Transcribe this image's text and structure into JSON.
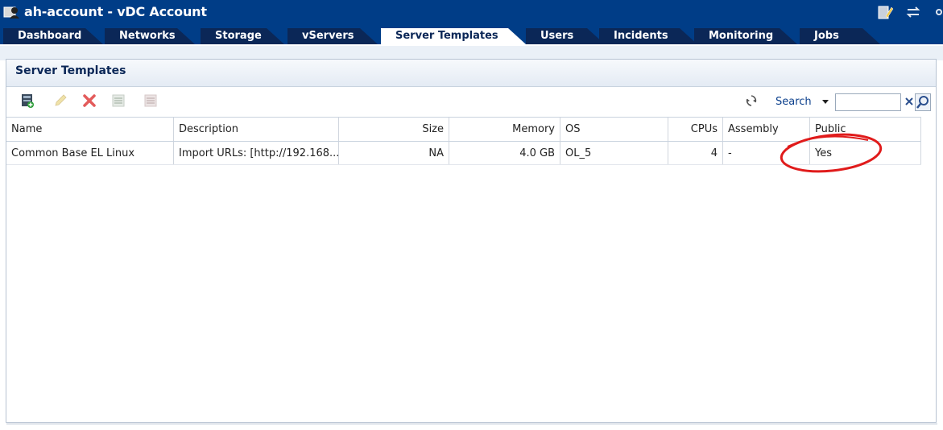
{
  "window": {
    "title": "ah-account - vDC Account"
  },
  "tabs": [
    {
      "label": "Dashboard",
      "active": false
    },
    {
      "label": "Networks",
      "active": false
    },
    {
      "label": "Storage",
      "active": false
    },
    {
      "label": "vServers",
      "active": false
    },
    {
      "label": "Server Templates",
      "active": true
    },
    {
      "label": "Users",
      "active": false
    },
    {
      "label": "Incidents",
      "active": false
    },
    {
      "label": "Monitoring",
      "active": false
    },
    {
      "label": "Jobs",
      "active": false
    }
  ],
  "panel": {
    "title": "Server Templates"
  },
  "toolbar": {
    "icons": [
      "add-template-icon",
      "edit-icon",
      "delete-icon",
      "export-icon",
      "import-icon",
      "refresh-icon"
    ],
    "search_label": "Search",
    "search_value": ""
  },
  "table": {
    "columns": [
      "Name",
      "Description",
      "Size",
      "Memory",
      "OS",
      "CPUs",
      "Assembly",
      "Public"
    ],
    "rows": [
      {
        "name": "Common Base EL Linux",
        "description": "Import URLs: [http://192.168....",
        "size": "NA",
        "memory": "4.0 GB",
        "os": "OL_5",
        "cpus": "4",
        "assembly": "-",
        "public": "Yes"
      }
    ]
  },
  "colors": {
    "header_bg": "#003d87",
    "tab_bg": "#0b2757",
    "annotation": "#e01b1b"
  }
}
